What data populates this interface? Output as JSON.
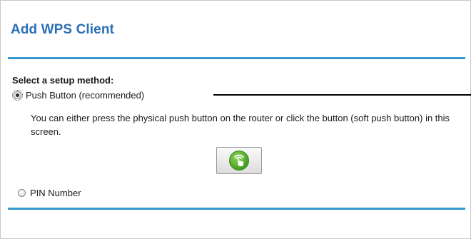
{
  "title": "Add WPS Client",
  "setup": {
    "label": "Select a setup method:",
    "options": [
      {
        "label": "Push Button (recommended)",
        "selected": true
      },
      {
        "label": "PIN Number",
        "selected": false
      }
    ],
    "push_description": "You can either press the physical push button on the router or click the button (soft push button) in this screen."
  },
  "wps_button": {
    "icon": "wps-icon"
  },
  "colors": {
    "title": "#2a6fb5",
    "rule": "#3399cc",
    "icon_green": "#5cb52f"
  }
}
